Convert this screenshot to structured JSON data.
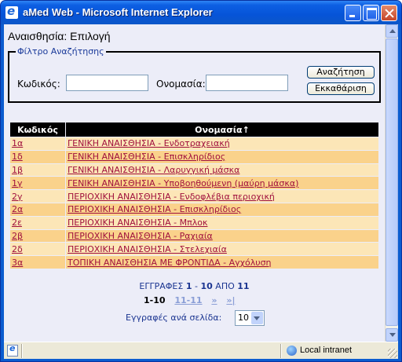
{
  "window": {
    "title": "aMed Web - Microsoft Internet Explorer"
  },
  "page": {
    "title": "Αναισθησία: Επιλογή"
  },
  "filter": {
    "legend": "Φίλτρο Αναζήτησης",
    "code_label": "Κωδικός:",
    "code_value": "",
    "name_label": "Ονομασία:",
    "name_value": "",
    "search_button": "Αναζήτηση",
    "clear_button": "Εκκαθάριση"
  },
  "table": {
    "headers": [
      "Κωδικός",
      "Ονομασία↑"
    ],
    "rows": [
      [
        "1α",
        "ΓΕΝΙΚΗ ΑΝΑΙΣΘΗΣΙΑ - Ενδοτραχειακή"
      ],
      [
        "1δ",
        "ΓΕΝΙΚΗ ΑΝΑΙΣΘΗΣΙΑ - Επισκληρίδιος"
      ],
      [
        "1β",
        "ΓΕΝΙΚΗ ΑΝΑΙΣΘΗΣΙΑ - Λαρυγγική μάσκα"
      ],
      [
        "1γ",
        "ΓΕΝΙΚΗ ΑΝΑΙΣΘΗΣΙΑ - Υποβοηθούμενη (μαύρη μάσκα)"
      ],
      [
        "2γ",
        "ΠΕΡΙΟΧΙΚΗ ΑΝΑΙΣΘΗΣΙΑ - Ενδοφλέβια περιοχική"
      ],
      [
        "2α",
        "ΠΕΡΙΟΧΙΚΗ ΑΝΑΙΣΘΗΣΙΑ - Επισκληρίδιος"
      ],
      [
        "2ε",
        "ΠΕΡΙΟΧΙΚΗ ΑΝΑΙΣΘΗΣΙΑ - Μπλοκ"
      ],
      [
        "2β",
        "ΠΕΡΙΟΧΙΚΗ ΑΝΑΙΣΘΗΣΙΑ - Ραχιαία"
      ],
      [
        "2δ",
        "ΠΕΡΙΟΧΙΚΗ ΑΝΑΙΣΘΗΣΙΑ - Στελεχιαία"
      ],
      [
        "3α",
        "ΤΟΠΙΚΗ ΑΝΑΙΣΘΗΣΙΑ ΜΕ ΦΡΟΝΤΙΔΑ - Αγχόλυση"
      ]
    ]
  },
  "paging": {
    "records_prefix": "ΕΓΓΡΑΦΕΣ",
    "range_start": "1",
    "range_sep": "-",
    "range_end": "10",
    "of_label": "ΑΠΟ",
    "total": "11",
    "current_page": "1-10",
    "next_page": "11-11",
    "next_arrow": "»",
    "last_arrow": "»|",
    "per_page_label": "Εγγραφές ανά σελίδα:",
    "per_page_value": "10"
  },
  "status": {
    "zone": "Local intranet"
  },
  "colors": {
    "row_light": "#fce6b7",
    "row_dark": "#fad28b",
    "link": "#a0103e",
    "header_bg": "#000000",
    "page_bg": "#ecedf8"
  }
}
